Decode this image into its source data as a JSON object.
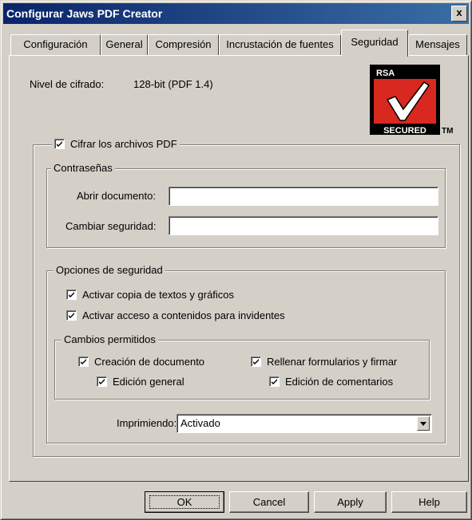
{
  "window": {
    "title": "Configurar Jaws PDF Creator",
    "close_glyph": "x"
  },
  "tabs": [
    {
      "label": "Configuración",
      "active": false
    },
    {
      "label": "General",
      "active": false
    },
    {
      "label": "Compresión",
      "active": false
    },
    {
      "label": "Incrustación de fuentes",
      "active": false
    },
    {
      "label": "Seguridad",
      "active": true
    },
    {
      "label": "Mensajes",
      "active": false
    }
  ],
  "security": {
    "encryption_label": "Nivel de cifrado:",
    "encryption_value": "128-bit (PDF 1.4)",
    "logo": {
      "top_text": "RSA",
      "bottom_text": "SECURED",
      "tm_text": "TM",
      "colors": {
        "red": "#d8281f",
        "black": "#000000",
        "white": "#ffffff"
      }
    },
    "encrypt_pdf": {
      "label": "Cifrar los archivos PDF",
      "checked": true
    },
    "passwords": {
      "legend": "Contraseñas",
      "open_label": "Abrir documento:",
      "open_value": "",
      "change_label": "Cambiar seguridad:",
      "change_value": ""
    },
    "options": {
      "legend": "Opciones de seguridad",
      "copy": {
        "label": "Activar copia de textos y gráficos",
        "checked": true
      },
      "accessibility": {
        "label": "Activar acceso a contenidos para invidentes",
        "checked": true
      },
      "changes": {
        "legend": "Cambios permitidos",
        "creation": {
          "label": "Creación de documento",
          "checked": true
        },
        "forms": {
          "label": "Rellenar formularios y firmar",
          "checked": true
        },
        "general_edit": {
          "label": "Edición general",
          "checked": true
        },
        "comments": {
          "label": "Edición de comentarios",
          "checked": true
        }
      },
      "printing": {
        "label": "Imprimiendo:",
        "value": "Activado"
      }
    }
  },
  "buttons": {
    "ok": "OK",
    "cancel": "Cancel",
    "apply": "Apply",
    "help": "Help"
  },
  "colors": {
    "face": "#d4d0c8",
    "title_start": "#0a246a",
    "title_end": "#3a6ea5"
  }
}
